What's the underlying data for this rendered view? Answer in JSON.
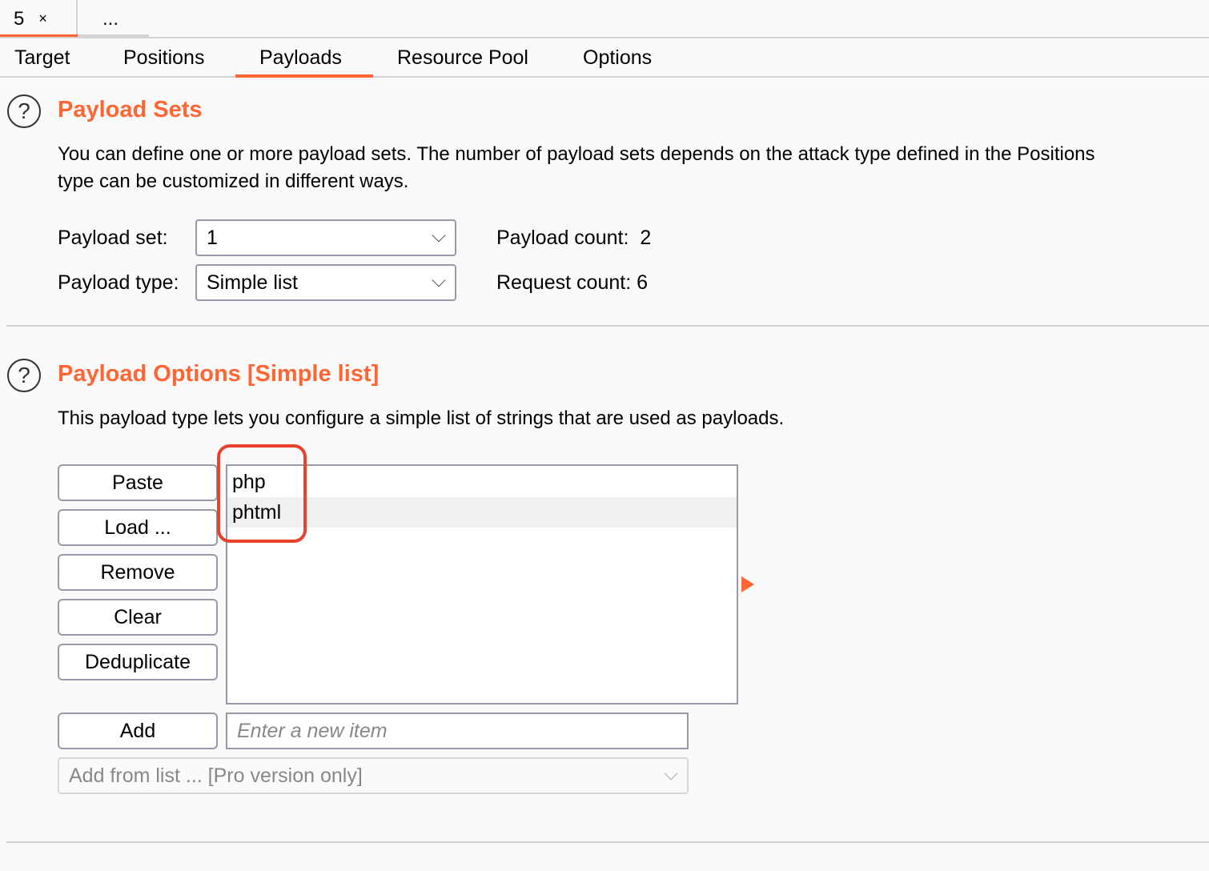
{
  "top_tabs": {
    "active": {
      "label": "5",
      "close": "×"
    },
    "more": "..."
  },
  "sub_tabs": [
    "Target",
    "Positions",
    "Payloads",
    "Resource Pool",
    "Options"
  ],
  "active_sub_tab": "Payloads",
  "colors": {
    "accent": "#ff6633",
    "highlight": "#e8412c"
  },
  "payload_sets": {
    "help_icon": "?",
    "title": "Payload Sets",
    "description_line1": "You can define one or more payload sets. The number of payload sets depends on the attack type defined in the Positions",
    "description_line2": "type can be customized in different ways.",
    "payload_set_label": "Payload set:",
    "payload_set_value": "1",
    "payload_type_label": "Payload type:",
    "payload_type_value": "Simple list",
    "payload_count_label": "Payload count:",
    "payload_count_value": "2",
    "request_count_label": "Request count:",
    "request_count_value": "6"
  },
  "payload_options": {
    "help_icon": "?",
    "title": "Payload Options [Simple list]",
    "description": "This payload type lets you configure a simple list of strings that are used as payloads.",
    "buttons": {
      "paste": "Paste",
      "load": "Load ...",
      "remove": "Remove",
      "clear": "Clear",
      "deduplicate": "Deduplicate",
      "add": "Add"
    },
    "items": [
      "php",
      "phtml"
    ],
    "selected_item": "phtml",
    "new_item_placeholder": "Enter a new item",
    "add_from_list": "Add from list ... [Pro version only]"
  }
}
